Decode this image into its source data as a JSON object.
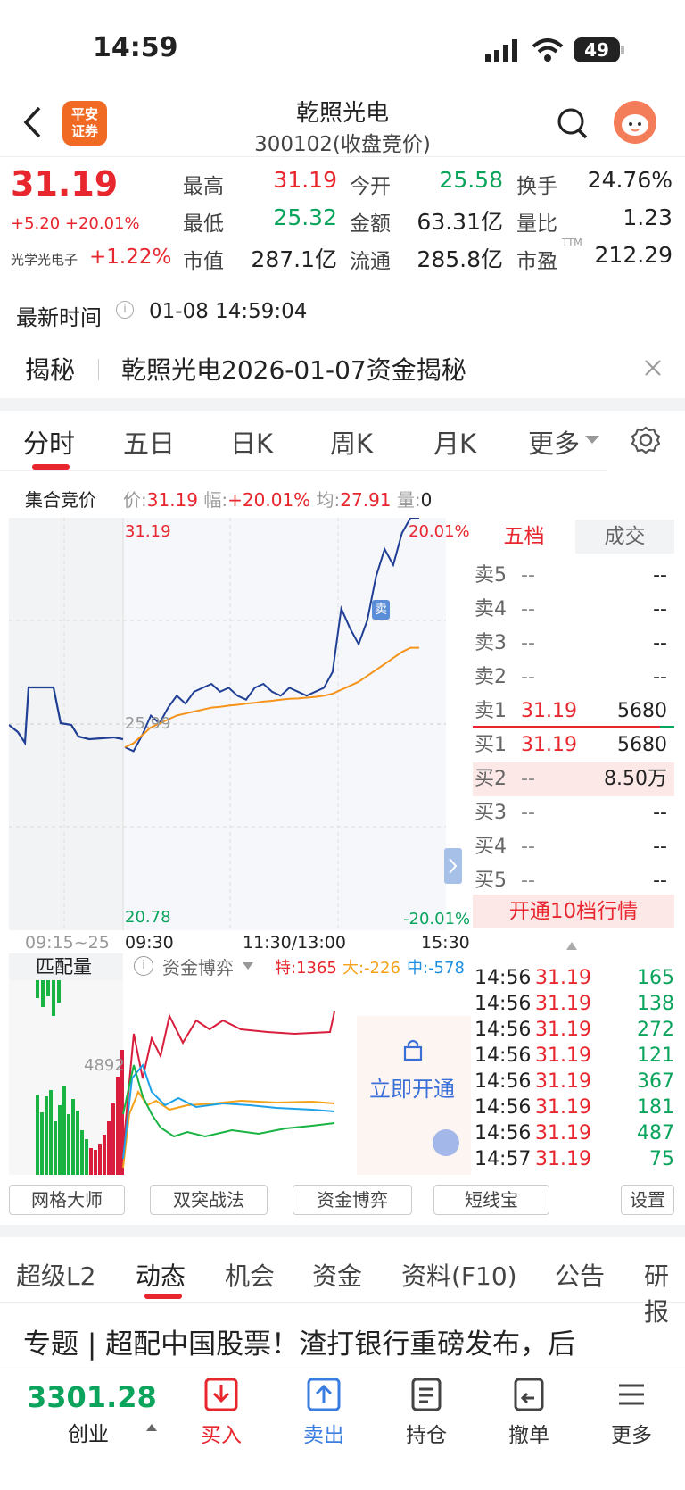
{
  "status": {
    "time": "14:59",
    "battery": "49"
  },
  "header": {
    "logo": "平安证券",
    "title": "乾照光电",
    "subtitle": "300102(收盘竞价)"
  },
  "quote": {
    "price": "31.19",
    "change": "+5.20 +20.01%",
    "sector_name": "光学光电子",
    "sector_change": "+1.22%",
    "fields": [
      {
        "label": "最高",
        "value": "31.19",
        "color": "red"
      },
      {
        "label": "今开",
        "value": "25.58",
        "color": "green"
      },
      {
        "label": "换手",
        "value": "24.76%",
        "color": "black"
      },
      {
        "label": "最低",
        "value": "25.32",
        "color": "green"
      },
      {
        "label": "金额",
        "value": "63.31亿",
        "color": "black"
      },
      {
        "label": "量比",
        "value": "1.23",
        "color": "black"
      },
      {
        "label": "市值",
        "value": "287.1亿",
        "color": "black"
      },
      {
        "label": "流通",
        "value": "285.8亿",
        "color": "black"
      },
      {
        "label": "市盈",
        "value": "212.29",
        "color": "black"
      }
    ],
    "pe_superscript": "TTM",
    "update_label": "最新时间",
    "update_time": "01-08 14:59:04"
  },
  "banner": {
    "tag": "揭秘",
    "text": "乾照光电2026-01-07资金揭秘"
  },
  "chart_tabs": [
    "分时",
    "五日",
    "日K",
    "周K",
    "月K",
    "更多"
  ],
  "auction": {
    "label": "集合竞价",
    "price_label": "价:",
    "price": "31.19",
    "pct_label": "幅:",
    "pct": "+20.01%",
    "avg_label": "均:",
    "avg": "27.91",
    "vol_label": "量:",
    "vol": "0"
  },
  "chart": {
    "top_price": "31.19",
    "mid_price": "25.99",
    "bottom_price": "20.78",
    "top_pct": "20.01%",
    "bottom_pct": "-20.01%",
    "sell_marker": "卖",
    "time_labels": [
      "09:15~25",
      "09:30",
      "11:30/13:00",
      "15:30"
    ]
  },
  "chart_data": {
    "type": "line",
    "title": "",
    "ylim": [
      20.78,
      31.19
    ],
    "series": [
      {
        "values": [
          25.4,
          25.3,
          25.7,
          26.2,
          26.0,
          26.4,
          26.7,
          26.5,
          26.8,
          26.9,
          27.0,
          26.8,
          26.9,
          26.7,
          26.6,
          26.9,
          27.0,
          26.8,
          26.7,
          26.9,
          26.8,
          26.7,
          26.8,
          26.9,
          27.3,
          28.9,
          28.4,
          28.0,
          28.6,
          29.7,
          30.4,
          30.0,
          30.8,
          31.19,
          31.19
        ]
      },
      {
        "values": [
          25.4,
          25.5,
          25.7,
          25.9,
          26.0,
          26.1,
          26.2,
          26.25,
          26.3,
          26.35,
          26.4,
          26.42,
          26.45,
          26.47,
          26.5,
          26.52,
          26.55,
          26.57,
          26.6,
          26.62,
          26.63,
          26.65,
          26.67,
          26.7,
          26.75,
          26.85,
          26.95,
          27.05,
          27.2,
          27.35,
          27.5,
          27.65,
          27.8,
          27.91,
          27.91
        ]
      }
    ]
  },
  "order_book": {
    "tabs": [
      "五档",
      "成交"
    ],
    "asks": [
      {
        "label": "卖5",
        "price": "--",
        "vol": "--"
      },
      {
        "label": "卖4",
        "price": "--",
        "vol": "--"
      },
      {
        "label": "卖3",
        "price": "--",
        "vol": "--"
      },
      {
        "label": "卖2",
        "price": "--",
        "vol": "--"
      },
      {
        "label": "卖1",
        "price": "31.19",
        "vol": "5680"
      }
    ],
    "bids": [
      {
        "label": "买1",
        "price": "31.19",
        "vol": "5680"
      },
      {
        "label": "买2",
        "price": "--",
        "vol": "8.50万"
      },
      {
        "label": "买3",
        "price": "--",
        "vol": "--"
      },
      {
        "label": "买4",
        "price": "--",
        "vol": "--"
      },
      {
        "label": "买5",
        "price": "--",
        "vol": "--"
      }
    ],
    "upgrade": "开通10档行情"
  },
  "trades": [
    {
      "time": "14:56",
      "price": "31.19",
      "vol": "165"
    },
    {
      "time": "14:56",
      "price": "31.19",
      "vol": "138"
    },
    {
      "time": "14:56",
      "price": "31.19",
      "vol": "272"
    },
    {
      "time": "14:56",
      "price": "31.19",
      "vol": "121"
    },
    {
      "time": "14:56",
      "price": "31.19",
      "vol": "367"
    },
    {
      "time": "14:56",
      "price": "31.19",
      "vol": "181"
    },
    {
      "time": "14:56",
      "price": "31.19",
      "vol": "487"
    },
    {
      "time": "14:57",
      "price": "31.19",
      "vol": "75"
    }
  ],
  "lower": {
    "match_label": "匹配量",
    "match_value": "4892",
    "capital_label": "资金博弈",
    "te": "特:1365",
    "da": "大:-226",
    "zhong": "中:-578",
    "unlock": "立即开通"
  },
  "tools": [
    "网格大师",
    "双突战法",
    "资金博弈",
    "短线宝",
    "设置"
  ],
  "bottom_tabs": [
    "超级L2",
    "动态",
    "机会",
    "资金",
    "资料(F10)",
    "公告",
    "研报"
  ],
  "news": "专题 | 超配中国股票！渣打银行重磅发布，后",
  "footer": {
    "index_value": "3301.28",
    "index_name": "创业",
    "actions": [
      "买入",
      "卖出",
      "持仓",
      "撤单",
      "更多"
    ]
  }
}
